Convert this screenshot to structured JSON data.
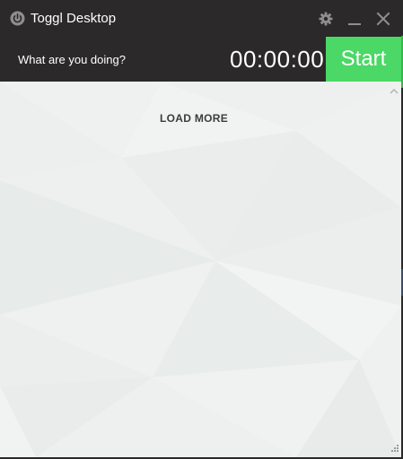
{
  "window": {
    "title": "Toggl Desktop",
    "icons": {
      "app": "power-icon",
      "settings": "gear-icon",
      "minimize": "minimize-icon",
      "close": "close-icon",
      "scroll_up": "chevron-up-icon",
      "resize": "resize-grip-icon"
    }
  },
  "timer": {
    "description_placeholder": "What are you doing?",
    "description_value": "",
    "duration": "00:00:00",
    "start_label": "Start"
  },
  "list": {
    "load_more_label": "LOAD MORE"
  },
  "colors": {
    "titlebar": "#2b2929",
    "start_button": "#4bd866",
    "content_bg": "#f1f3f2"
  }
}
